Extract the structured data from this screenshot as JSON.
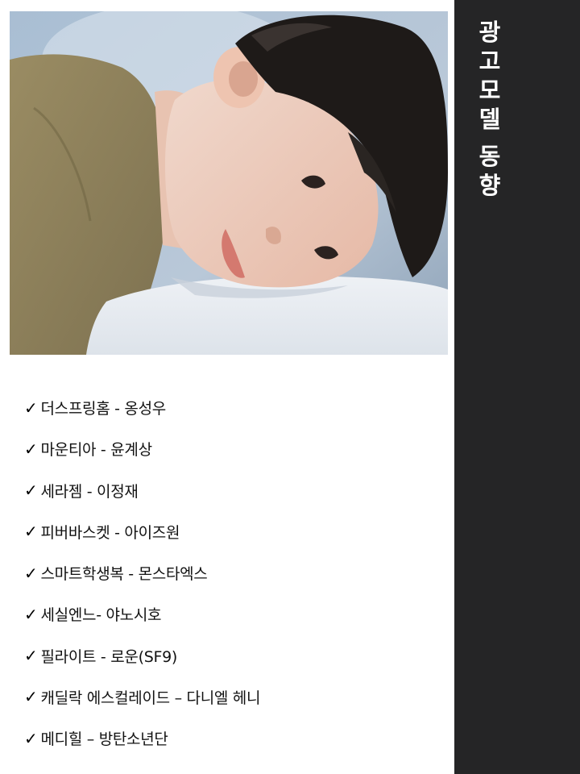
{
  "sidebar": {
    "title_chars": [
      "광",
      "고",
      "모",
      "델",
      "동",
      "향"
    ]
  },
  "photo": {
    "subject": "young man lying on a white pillow"
  },
  "list": {
    "check_mark": "✓",
    "items": [
      "더스프링홈 - 옹성우",
      "마운티아 - 윤계상",
      "세라젬 - 이정재",
      "피버바스켓 - 아이즈원",
      "스마트학생복 - 몬스타엑스",
      "세실엔느- 야노시호",
      "필라이트 - 로운(SF9)",
      "캐딜락 에스컬레이드 – 다니엘 헤니",
      "메디힐 – 방탄소년단"
    ]
  },
  "colors": {
    "sidebar_bg": "#252526",
    "sidebar_text": "#ffffff",
    "body_text": "#111111"
  }
}
